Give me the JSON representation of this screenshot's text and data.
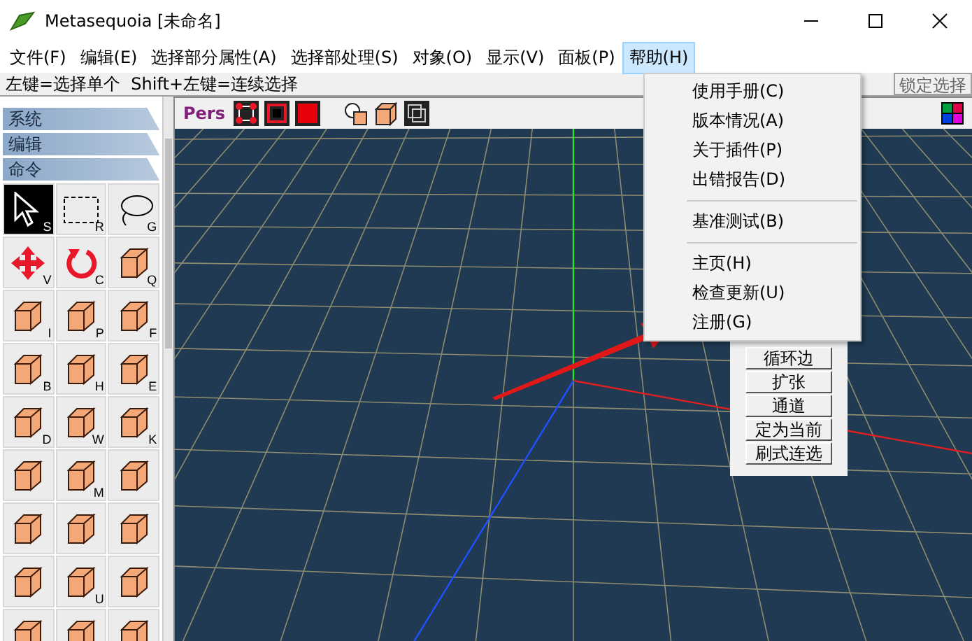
{
  "window": {
    "title": "Metasequoia [未命名]"
  },
  "menu_bar": [
    {
      "label": "文件(F)",
      "selected": false
    },
    {
      "label": "编辑(E)",
      "selected": false
    },
    {
      "label": "选择部分属性(A)",
      "selected": false
    },
    {
      "label": "选择部处理(S)",
      "selected": false
    },
    {
      "label": "对象(O)",
      "selected": false
    },
    {
      "label": "显示(V)",
      "selected": false
    },
    {
      "label": "面板(P)",
      "selected": false
    },
    {
      "label": "帮助(H)",
      "selected": true
    }
  ],
  "status_hint": "左键=选择单个  Shift+左键=连续选择",
  "lock_button": "锁定选择",
  "sidebar": {
    "sections": [
      "系统",
      "编辑",
      "命令"
    ],
    "tools": [
      {
        "kind": "cursor",
        "key": "S",
        "selected": true
      },
      {
        "kind": "rect",
        "key": "R",
        "selected": false
      },
      {
        "kind": "lasso",
        "key": "G",
        "selected": false
      },
      {
        "kind": "move",
        "key": "V",
        "selected": false
      },
      {
        "kind": "rotate",
        "key": "C",
        "selected": false
      },
      {
        "kind": "block",
        "key": "Q",
        "selected": false
      },
      {
        "kind": "block",
        "key": "I",
        "selected": false
      },
      {
        "kind": "block",
        "key": "P",
        "selected": false
      },
      {
        "kind": "block",
        "key": "F",
        "selected": false
      },
      {
        "kind": "block",
        "key": "B",
        "selected": false
      },
      {
        "kind": "block",
        "key": "H",
        "selected": false
      },
      {
        "kind": "block",
        "key": "E",
        "selected": false
      },
      {
        "kind": "block",
        "key": "D",
        "selected": false
      },
      {
        "kind": "block",
        "key": "W",
        "selected": false
      },
      {
        "kind": "block",
        "key": "K",
        "selected": false
      },
      {
        "kind": "block",
        "selected": false
      },
      {
        "kind": "block",
        "key": "M",
        "selected": false
      },
      {
        "kind": "block",
        "selected": false
      },
      {
        "kind": "block",
        "selected": false
      },
      {
        "kind": "block",
        "selected": false
      },
      {
        "kind": "block",
        "selected": false
      },
      {
        "kind": "block",
        "selected": false
      },
      {
        "kind": "block",
        "key": "U",
        "selected": false
      },
      {
        "kind": "block",
        "selected": false
      },
      {
        "kind": "block",
        "selected": false
      },
      {
        "kind": "block",
        "selected": false
      },
      {
        "kind": "block",
        "selected": false
      }
    ]
  },
  "viewport": {
    "view_label": "Pers"
  },
  "help_menu": {
    "groups": [
      {
        "items": [
          "使用手册(C)",
          "版本情况(A)",
          "关于插件(P)",
          "出错报告(D)"
        ]
      },
      {
        "items": [
          "基准测试(B)"
        ]
      },
      {
        "items": [
          "主页(H)",
          "检查更新(U)",
          "注册(G)"
        ]
      }
    ]
  },
  "command_panel": [
    "循环边",
    "扩张",
    "通道",
    "定为当前",
    "刷式连选"
  ]
}
